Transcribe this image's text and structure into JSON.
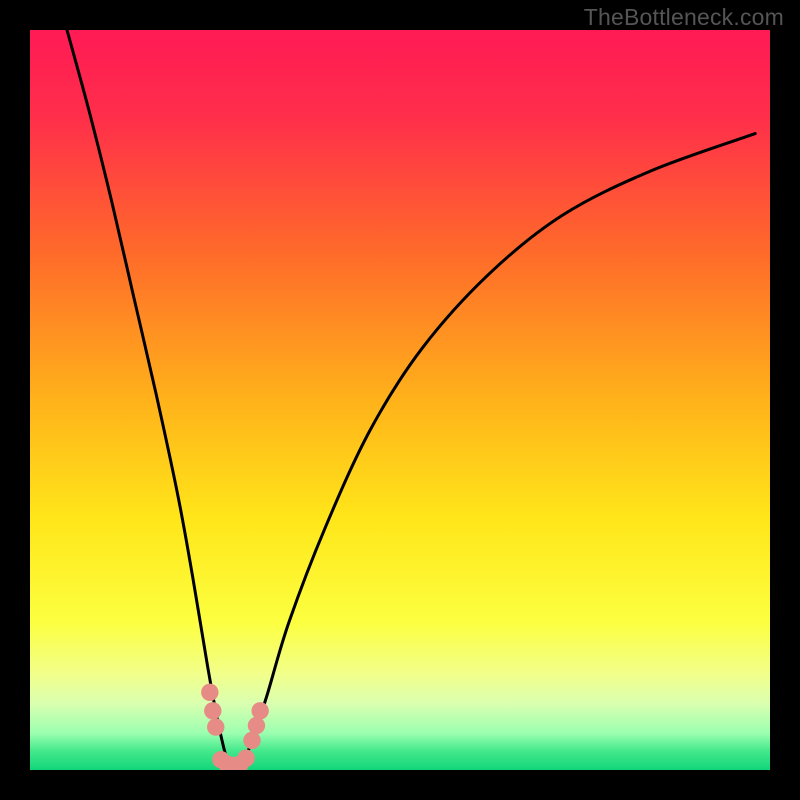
{
  "watermark": "TheBottleneck.com",
  "chart_data": {
    "type": "line",
    "title": "",
    "xlabel": "",
    "ylabel": "",
    "xlim": [
      0,
      100
    ],
    "ylim": [
      0,
      100
    ],
    "description": "V-shaped bottleneck curve with minimum near x≈27; vertical gradient background from red (high y, bad) through orange/yellow to green (low y, good).",
    "gradient_stops": [
      {
        "pos": 0.0,
        "color": "#ff1a55"
      },
      {
        "pos": 0.12,
        "color": "#ff2f4a"
      },
      {
        "pos": 0.3,
        "color": "#ff6a2a"
      },
      {
        "pos": 0.5,
        "color": "#ffb21a"
      },
      {
        "pos": 0.66,
        "color": "#ffe619"
      },
      {
        "pos": 0.8,
        "color": "#fcff40"
      },
      {
        "pos": 0.87,
        "color": "#f2ff8a"
      },
      {
        "pos": 0.91,
        "color": "#daffb0"
      },
      {
        "pos": 0.95,
        "color": "#9cffb0"
      },
      {
        "pos": 0.975,
        "color": "#42e88b"
      },
      {
        "pos": 1.0,
        "color": "#12d57a"
      }
    ],
    "series": [
      {
        "name": "bottleneck-curve",
        "x": [
          5,
          8,
          11,
          14,
          17,
          20,
          22,
          24,
          25.5,
          27,
          28.5,
          30,
          32,
          35,
          40,
          46,
          53,
          62,
          72,
          84,
          98
        ],
        "y": [
          100,
          89,
          77,
          64,
          51,
          37,
          26,
          14,
          6,
          0.5,
          0.5,
          4,
          10,
          20,
          33,
          46,
          57,
          67,
          75,
          81,
          86
        ]
      }
    ],
    "markers": [
      {
        "x": 24.3,
        "y": 10.5
      },
      {
        "x": 24.7,
        "y": 8.0
      },
      {
        "x": 25.1,
        "y": 5.8
      },
      {
        "x": 30.0,
        "y": 4.0
      },
      {
        "x": 30.6,
        "y": 6.0
      },
      {
        "x": 31.1,
        "y": 8.0
      },
      {
        "x": 25.8,
        "y": 1.4
      },
      {
        "x": 26.6,
        "y": 0.8
      },
      {
        "x": 27.5,
        "y": 0.6
      },
      {
        "x": 28.4,
        "y": 0.8
      },
      {
        "x": 29.2,
        "y": 1.6
      }
    ]
  }
}
